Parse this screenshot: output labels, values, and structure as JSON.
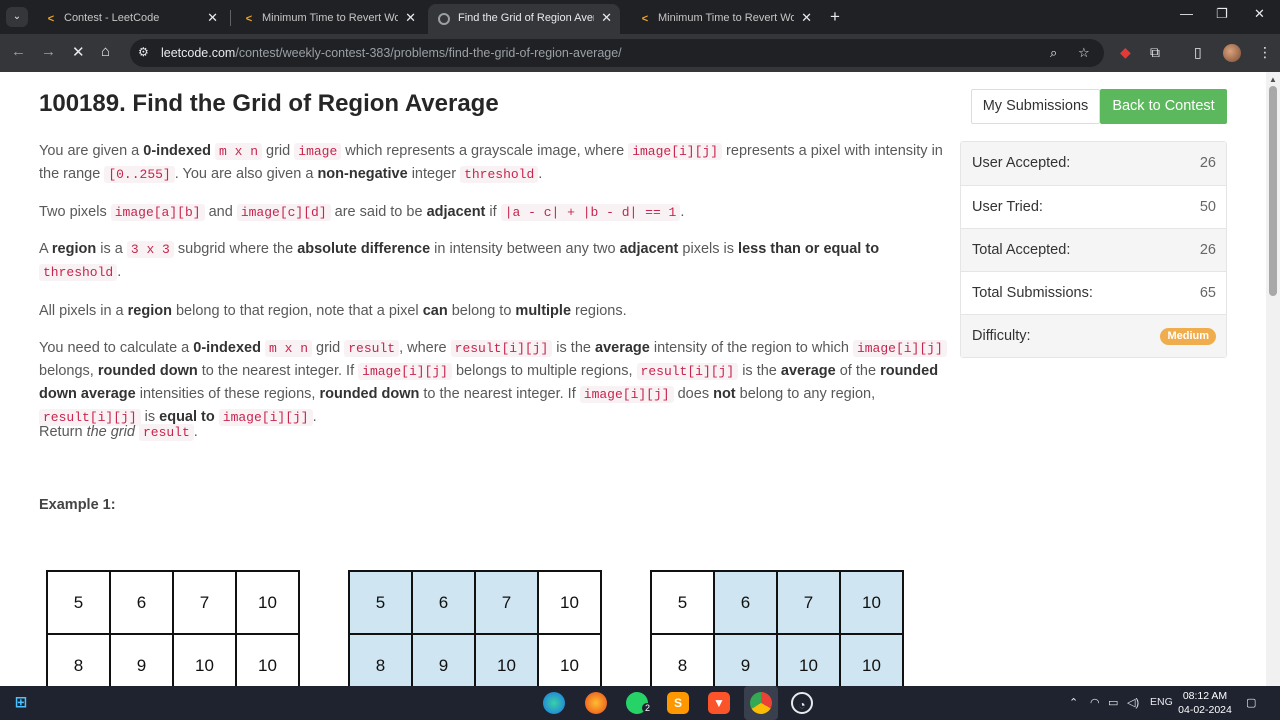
{
  "browser": {
    "tabs": [
      {
        "title": "Contest - LeetCode",
        "active": false
      },
      {
        "title": "Minimum Time to Revert Word",
        "active": false
      },
      {
        "title": "Find the Grid of Region Average",
        "active": true
      },
      {
        "title": "Minimum Time to Revert Word",
        "active": false
      }
    ],
    "url_host": "leetcode.com",
    "url_path": "/contest/weekly-contest-383/problems/find-the-grid-of-region-average/"
  },
  "problem": {
    "title": "100189. Find the Grid of Region Average",
    "my_submissions_label": "My Submissions",
    "back_label": "Back to Contest"
  },
  "stats": [
    {
      "label": "User Accepted:",
      "value": "26"
    },
    {
      "label": "User Tried:",
      "value": "50"
    },
    {
      "label": "Total Accepted:",
      "value": "26"
    },
    {
      "label": "Total Submissions:",
      "value": "65"
    },
    {
      "label": "Difficulty:",
      "value": "Medium"
    }
  ],
  "description": {
    "p1": [
      {
        "t": "text",
        "v": "You are given a "
      },
      {
        "t": "bold",
        "v": "0-indexed"
      },
      {
        "t": "text",
        "v": " "
      },
      {
        "t": "code",
        "v": "m x n"
      },
      {
        "t": "text",
        "v": " grid "
      },
      {
        "t": "code",
        "v": "image"
      },
      {
        "t": "text",
        "v": " which represents a grayscale image, where "
      },
      {
        "t": "code",
        "v": "image[i][j]"
      },
      {
        "t": "text",
        "v": " represents a pixel with intensity in the range "
      },
      {
        "t": "code",
        "v": "[0..255]"
      },
      {
        "t": "text",
        "v": ". You are also given a "
      },
      {
        "t": "bold",
        "v": "non-negative"
      },
      {
        "t": "text",
        "v": " integer "
      },
      {
        "t": "code",
        "v": "threshold"
      },
      {
        "t": "text",
        "v": "."
      }
    ],
    "p2": [
      {
        "t": "text",
        "v": "Two pixels "
      },
      {
        "t": "code",
        "v": "image[a][b]"
      },
      {
        "t": "text",
        "v": " and "
      },
      {
        "t": "code",
        "v": "image[c][d]"
      },
      {
        "t": "text",
        "v": " are said to be "
      },
      {
        "t": "bold",
        "v": "adjacent"
      },
      {
        "t": "text",
        "v": " if "
      },
      {
        "t": "code",
        "v": "|a - c| + |b - d| == 1"
      },
      {
        "t": "text",
        "v": "."
      }
    ],
    "p3": [
      {
        "t": "text",
        "v": "A "
      },
      {
        "t": "bold",
        "v": "region"
      },
      {
        "t": "text",
        "v": " is a "
      },
      {
        "t": "code",
        "v": "3 x 3"
      },
      {
        "t": "text",
        "v": " subgrid where the "
      },
      {
        "t": "bold",
        "v": "absolute difference"
      },
      {
        "t": "text",
        "v": " in intensity between any two "
      },
      {
        "t": "bold",
        "v": "adjacent"
      },
      {
        "t": "text",
        "v": " pixels is "
      },
      {
        "t": "bold",
        "v": "less than or equal to"
      },
      {
        "t": "text",
        "v": " "
      },
      {
        "t": "code",
        "v": "threshold"
      },
      {
        "t": "text",
        "v": "."
      }
    ],
    "p4": [
      {
        "t": "text",
        "v": "All pixels in a "
      },
      {
        "t": "bold",
        "v": "region"
      },
      {
        "t": "text",
        "v": " belong to that region, note that a pixel "
      },
      {
        "t": "bold",
        "v": "can"
      },
      {
        "t": "text",
        "v": " belong to "
      },
      {
        "t": "bold",
        "v": "multiple"
      },
      {
        "t": "text",
        "v": " regions."
      }
    ],
    "p5": [
      {
        "t": "text",
        "v": "You need to calculate a "
      },
      {
        "t": "bold",
        "v": "0-indexed"
      },
      {
        "t": "text",
        "v": " "
      },
      {
        "t": "code",
        "v": "m x n"
      },
      {
        "t": "text",
        "v": " grid "
      },
      {
        "t": "code",
        "v": "result"
      },
      {
        "t": "text",
        "v": ", where "
      },
      {
        "t": "code",
        "v": "result[i][j]"
      },
      {
        "t": "text",
        "v": " is the "
      },
      {
        "t": "bold",
        "v": "average"
      },
      {
        "t": "text",
        "v": " intensity of the region to which "
      },
      {
        "t": "code",
        "v": "image[i][j]"
      },
      {
        "t": "text",
        "v": " belongs, "
      },
      {
        "t": "bold",
        "v": "rounded down"
      },
      {
        "t": "text",
        "v": " to the nearest integer. If "
      },
      {
        "t": "code",
        "v": "image[i][j]"
      },
      {
        "t": "text",
        "v": " belongs to multiple regions, "
      },
      {
        "t": "code",
        "v": "result[i][j]"
      },
      {
        "t": "text",
        "v": " is the "
      },
      {
        "t": "bold",
        "v": "average"
      },
      {
        "t": "text",
        "v": " of the "
      },
      {
        "t": "bold",
        "v": "rounded down average"
      },
      {
        "t": "text",
        "v": " intensities of these regions, "
      },
      {
        "t": "bold",
        "v": "rounded down"
      },
      {
        "t": "text",
        "v": " to the nearest integer. If "
      },
      {
        "t": "code",
        "v": "image[i][j]"
      },
      {
        "t": "text",
        "v": " does "
      },
      {
        "t": "bold",
        "v": "not"
      },
      {
        "t": "text",
        "v": " belong to any region, "
      },
      {
        "t": "code",
        "v": "result[i][j]"
      },
      {
        "t": "text",
        "v": " is "
      },
      {
        "t": "bold",
        "v": "equal to"
      },
      {
        "t": "text",
        "v": " "
      },
      {
        "t": "code",
        "v": "image[i][j]"
      },
      {
        "t": "text",
        "v": "."
      }
    ],
    "p6": [
      {
        "t": "text",
        "v": "Return "
      },
      {
        "t": "italic",
        "v": "the grid"
      },
      {
        "t": "text",
        "v": " "
      },
      {
        "t": "code",
        "v": "result"
      },
      {
        "t": "text",
        "v": "."
      }
    ]
  },
  "example": {
    "title": "Example 1:",
    "grids": [
      {
        "rows": [
          [
            5,
            6,
            7,
            10
          ],
          [
            8,
            9,
            10,
            10
          ]
        ],
        "highlight": [
          [
            false,
            false,
            false,
            false
          ],
          [
            false,
            false,
            false,
            false
          ]
        ]
      },
      {
        "rows": [
          [
            5,
            6,
            7,
            10
          ],
          [
            8,
            9,
            10,
            10
          ]
        ],
        "highlight": [
          [
            true,
            true,
            true,
            false
          ],
          [
            true,
            true,
            true,
            false
          ]
        ]
      },
      {
        "rows": [
          [
            5,
            6,
            7,
            10
          ],
          [
            8,
            9,
            10,
            10
          ]
        ],
        "highlight": [
          [
            false,
            true,
            true,
            true
          ],
          [
            false,
            true,
            true,
            true
          ]
        ]
      }
    ]
  },
  "taskbar": {
    "lang": "ENG",
    "time": "08:12 AM",
    "date": "04-02-2024",
    "whatsapp_badge": "2"
  }
}
